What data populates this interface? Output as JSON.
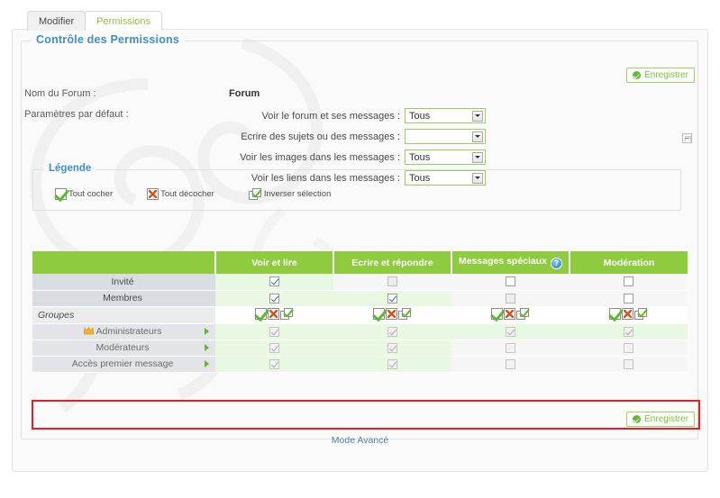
{
  "tabs": [
    {
      "label": "Modifier",
      "active": false
    },
    {
      "label": "Permissions",
      "active": true
    }
  ],
  "section": {
    "title": "Contrôle des Permissions"
  },
  "buttons": {
    "save_top": "Enregistrer",
    "save_bottom": "Enregistrer",
    "advanced_mode": "Mode Avancé"
  },
  "form": {
    "forum_name_label": "Nom du Forum :",
    "forum_name_value": "Forum",
    "default_params_label": "Paramètres par défaut :",
    "rows": [
      {
        "label": "Voir le forum et ses messages :",
        "value": "Tous"
      },
      {
        "label": "Ecrire des sujets ou des messages :",
        "value": ""
      },
      {
        "label": "Voir les images dans les messages :",
        "value": "Tous"
      },
      {
        "label": "Voir les liens dans les messages :",
        "value": "Tous"
      }
    ]
  },
  "legend": {
    "title": "Légende",
    "items": [
      {
        "label": "Tout cocher",
        "icon": "check-all-icon"
      },
      {
        "label": "Tout décocher",
        "icon": "uncheck-all-icon"
      },
      {
        "label": "Inverser sélection",
        "icon": "invert-selection-icon"
      }
    ]
  },
  "table": {
    "headers": [
      "",
      "Voir et lire",
      "Ecrire et répondre",
      "Messages spéciaux",
      "Modération"
    ],
    "header_help_icon": "help-icon",
    "rows": [
      {
        "label": "Invité",
        "type": "member",
        "cells": [
          {
            "state": "checked",
            "shade": "green"
          },
          {
            "state": "shaded",
            "shade": "gray"
          },
          {
            "state": "unchecked",
            "shade": "gray"
          },
          {
            "state": "unchecked",
            "shade": "gray"
          }
        ]
      },
      {
        "label": "Membres",
        "type": "member",
        "cells": [
          {
            "state": "checked",
            "shade": "green"
          },
          {
            "state": "checked",
            "shade": "green"
          },
          {
            "state": "shaded",
            "shade": "gray"
          },
          {
            "state": "unchecked",
            "shade": "gray"
          }
        ]
      },
      {
        "label": "Groupes",
        "type": "group-header",
        "cells": [
          {
            "state": "actions",
            "shade": "white"
          },
          {
            "state": "actions",
            "shade": "white"
          },
          {
            "state": "actions",
            "shade": "white"
          },
          {
            "state": "actions",
            "shade": "white"
          }
        ]
      },
      {
        "label": "Administrateurs",
        "type": "subgroup",
        "icon": "crown-icon",
        "marker": "arrow-right-icon",
        "cells": [
          {
            "state": "disabled-checked",
            "shade": "green"
          },
          {
            "state": "disabled-checked",
            "shade": "green"
          },
          {
            "state": "disabled-checked",
            "shade": "green"
          },
          {
            "state": "disabled-checked",
            "shade": "green"
          }
        ]
      },
      {
        "label": "Modérateurs",
        "type": "subgroup",
        "marker": "arrow-right-icon",
        "cells": [
          {
            "state": "disabled-checked",
            "shade": "green"
          },
          {
            "state": "disabled-checked",
            "shade": "green"
          },
          {
            "state": "disabled-unchecked",
            "shade": "gray"
          },
          {
            "state": "disabled-unchecked",
            "shade": "gray"
          }
        ]
      },
      {
        "label": "Accès premier message",
        "type": "subgroup",
        "marker": "arrow-right-icon",
        "highlighted": true,
        "cells": [
          {
            "state": "disabled-checked",
            "shade": "green"
          },
          {
            "state": "disabled-checked",
            "shade": "green"
          },
          {
            "state": "disabled-unchecked",
            "shade": "gray"
          },
          {
            "state": "disabled-unchecked",
            "shade": "gray"
          }
        ]
      }
    ]
  },
  "colors": {
    "header_green": "#8ecb3e",
    "accent_blue": "#3f8fc7",
    "cell_green": "#e8f8e2",
    "label_gray": "#d9dce0",
    "highlight_red": "#ee1c1c",
    "save_green": "#7ec13d"
  }
}
